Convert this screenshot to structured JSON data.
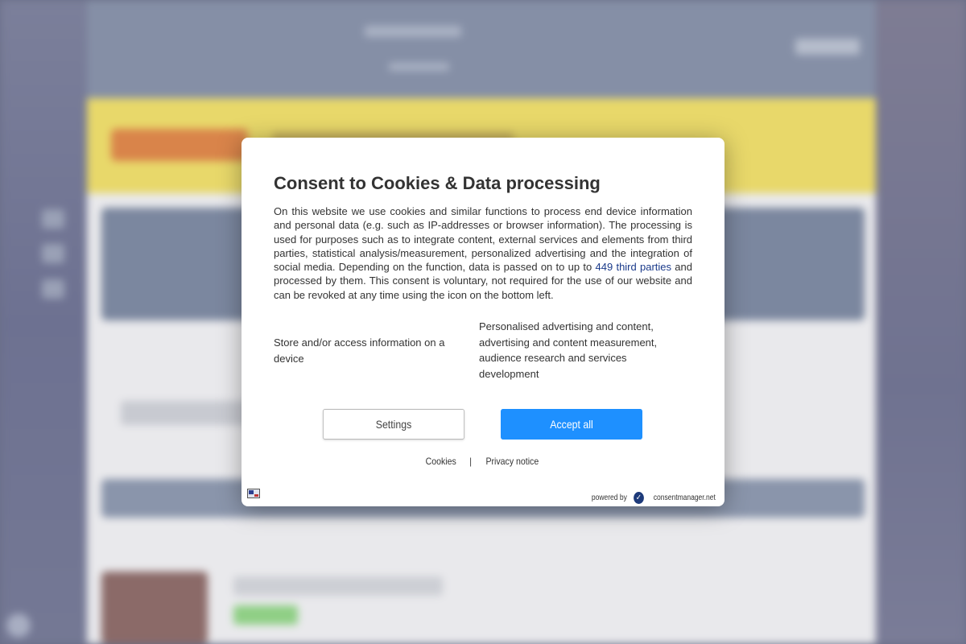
{
  "consent_dialog": {
    "title": "Consent to Cookies & Data processing",
    "body_before_link": "On this website we use cookies and similar functions to process end device information and personal data (e.g. such as IP-addresses or browser information). The processing is used for purposes such as to integrate content, external services and elements from third parties, statistical analysis/measurement, personalized advertising and the integration of social media. Depending on the function, data is passed on to up to ",
    "third_parties_link": "449 third parties",
    "body_after_link": " and processed by them. This consent is voluntary, not required for the use of our website and can be revoked at any time using the icon on the bottom left.",
    "purposes": [
      "Store and/or access information on a device",
      "Personalised advertising and content, advertising and content measurement, audience research and services development"
    ],
    "settings_label": "Settings",
    "accept_label": "Accept all",
    "links": {
      "cookies": "Cookies",
      "separator": "|",
      "privacy": "Privacy notice"
    },
    "powered_by": "powered by",
    "provider": "consentmanager.net",
    "language_icon": "language-flag-icon",
    "accent_color": "#1e90ff"
  }
}
